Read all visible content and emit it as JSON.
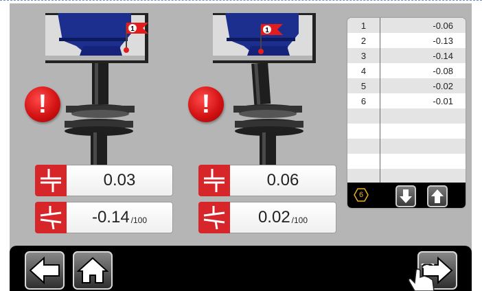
{
  "left_panel": {
    "parallel_value": "0.03",
    "angular_value": "-0.14",
    "angular_unit": "/100",
    "flag_number": "1",
    "alert_symbol": "!"
  },
  "right_panel": {
    "parallel_value": "0.06",
    "angular_value": "0.02",
    "angular_unit": "/100",
    "flag_number": "1",
    "alert_symbol": "!"
  },
  "measurements": {
    "rows": [
      {
        "index": "1",
        "value": "-0.06"
      },
      {
        "index": "2",
        "value": "-0.13"
      },
      {
        "index": "3",
        "value": "-0.14"
      },
      {
        "index": "4",
        "value": "-0.08"
      },
      {
        "index": "5",
        "value": "-0.02"
      },
      {
        "index": "6",
        "value": "-0.01"
      }
    ],
    "count": "6"
  },
  "icons": {
    "back": "arrow-left-icon",
    "home": "home-icon",
    "next": "arrow-right-icon",
    "scroll_down": "arrow-down-icon",
    "scroll_up": "arrow-up-icon",
    "alert": "exclamation-icon",
    "pointer": "hand-pointer-icon"
  },
  "colors": {
    "screen_bg": "#b5b5b5",
    "alert_red": "#d41414",
    "motor_blue": "#1c2f8f",
    "count_orange": "#f0b020"
  }
}
